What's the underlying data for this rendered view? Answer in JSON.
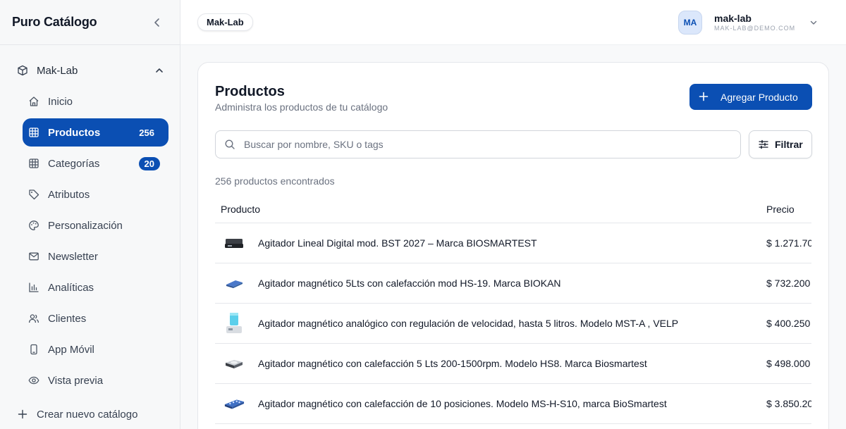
{
  "sidebar": {
    "brand": "Puro Catálogo",
    "catalog_name": "Mak-Lab",
    "items": [
      {
        "label": "Inicio"
      },
      {
        "label": "Productos",
        "count": "256"
      },
      {
        "label": "Categorías",
        "count": "20"
      },
      {
        "label": "Atributos"
      },
      {
        "label": "Personalización"
      },
      {
        "label": "Newsletter"
      },
      {
        "label": "Analíticas"
      },
      {
        "label": "Clientes"
      },
      {
        "label": "App Móvil"
      },
      {
        "label": "Vista previa"
      }
    ],
    "new_catalog": "Crear nuevo catálogo"
  },
  "topbar": {
    "catalog_chip": "Mak-Lab",
    "user": {
      "initials": "MA",
      "name": "mak-lab",
      "email": "MAK-LAB@DEMO.COM"
    }
  },
  "main": {
    "title": "Productos",
    "subtitle": "Administra los productos de tu catálogo",
    "add_button": "Agregar Producto",
    "search_placeholder": "Buscar por nombre, SKU o tags",
    "filter_button": "Filtrar",
    "results_text": "256 productos encontrados",
    "columns": {
      "product": "Producto",
      "price": "Precio"
    },
    "rows": [
      {
        "name": "Agitador Lineal Digital mod. BST 2027 – Marca BIOSMARTEST",
        "price": "$ 1.271.70"
      },
      {
        "name": "Agitador magnético 5Lts con calefacción mod HS-19. Marca BIOKAN",
        "price": "$ 732.200"
      },
      {
        "name": "Agitador magnético analógico con regulación de velocidad, hasta 5 litros. Modelo MST-A , VELP",
        "price": "$ 400.250"
      },
      {
        "name": "Agitador magnético con calefacción 5 Lts 200-1500rpm. Modelo HS8. Marca Biosmartest",
        "price": "$ 498.000"
      },
      {
        "name": "Agitador magnético con calefacción de 10 posiciones. Modelo MS-H-S10, marca BioSmartest",
        "price": "$ 3.850.20"
      }
    ]
  },
  "colors": {
    "accent": "#0b4fb3"
  }
}
